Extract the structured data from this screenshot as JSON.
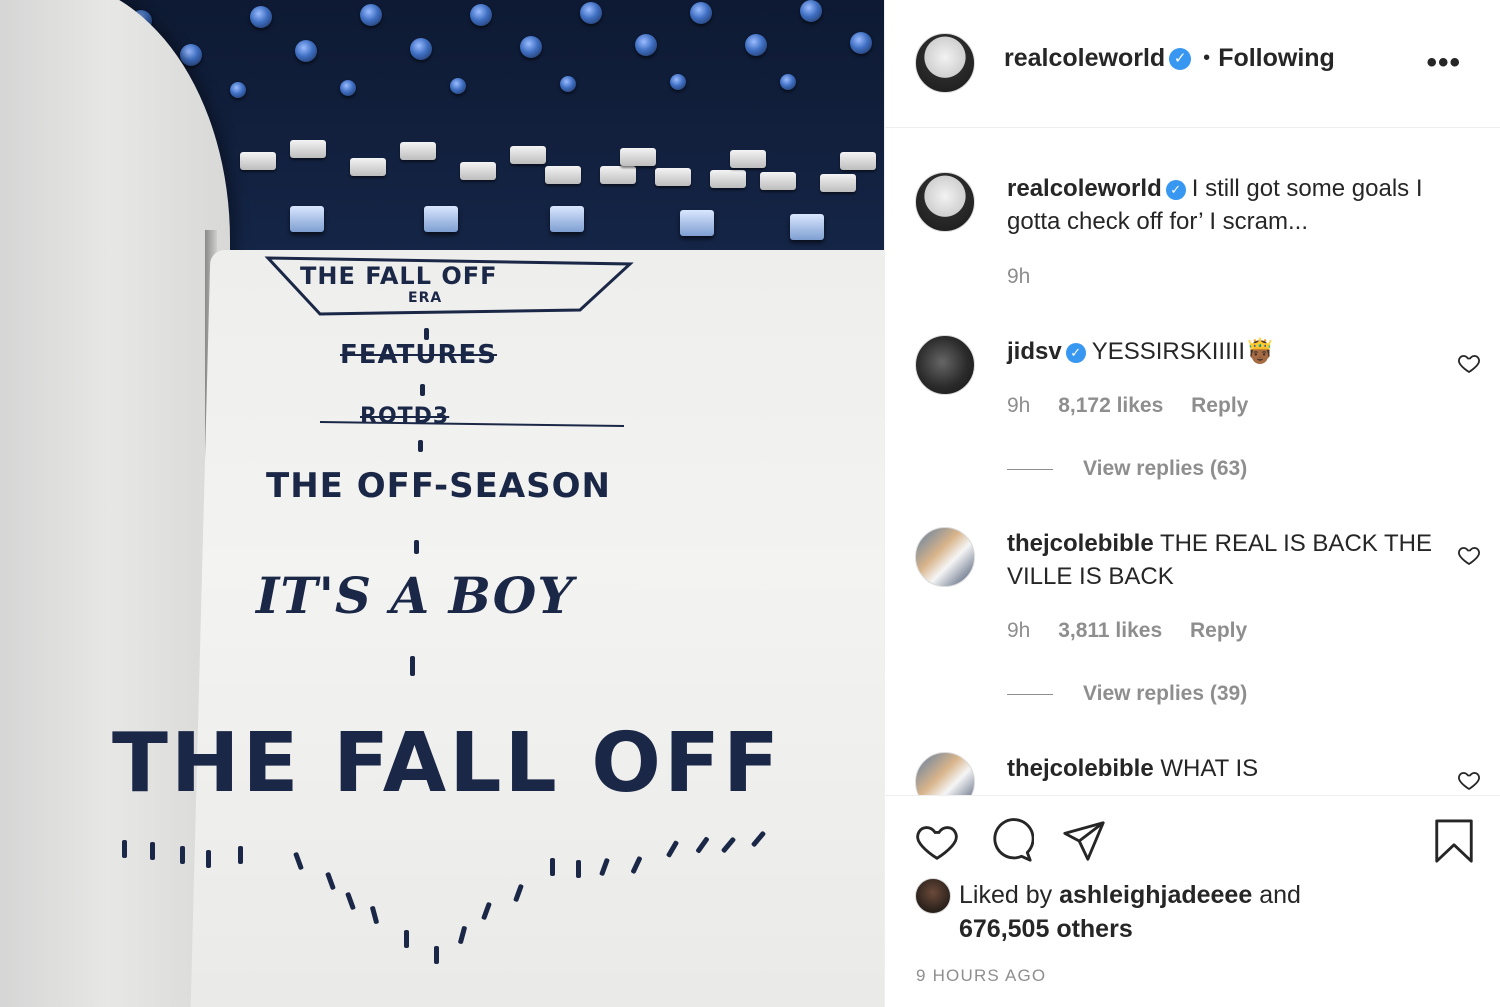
{
  "photo": {
    "notebook_lines": [
      "THE FALL OFF",
      "ERA",
      "FEATURES",
      "ROTD3",
      "THE OFF-SEASON",
      "IT'S A BOY",
      "THE FALL OFF"
    ]
  },
  "header": {
    "username": "realcoleworld",
    "separator": "•",
    "follow_label": "Following",
    "more_icon": "more-options-icon"
  },
  "caption": {
    "username": "realcoleworld",
    "text": "I still got some goals I gotta check off for’ I scram...",
    "time": "9h"
  },
  "comments": [
    {
      "username": "jidsv",
      "verified": true,
      "text": "YESSIRSKIIIII🤴🏾",
      "time": "9h",
      "likes": "8,172 likes",
      "reply": "Reply",
      "view_replies": "View replies (63)"
    },
    {
      "username": "thejcolebible",
      "verified": false,
      "text": "THE REAL IS BACK THE VILLE IS BACK",
      "time": "9h",
      "likes": "3,811 likes",
      "reply": "Reply",
      "view_replies": "View replies (39)"
    },
    {
      "username": "thejcolebible",
      "verified": false,
      "text": "WHAT IS"
    }
  ],
  "likes": {
    "prefix": "Liked by",
    "user": "ashleighjadeeee",
    "and": "and",
    "others": "676,505 others"
  },
  "timestamp": "9 HOURS AGO",
  "colors": {
    "verified": "#3897f0",
    "muted": "#8e8e8e",
    "text": "#262626"
  }
}
